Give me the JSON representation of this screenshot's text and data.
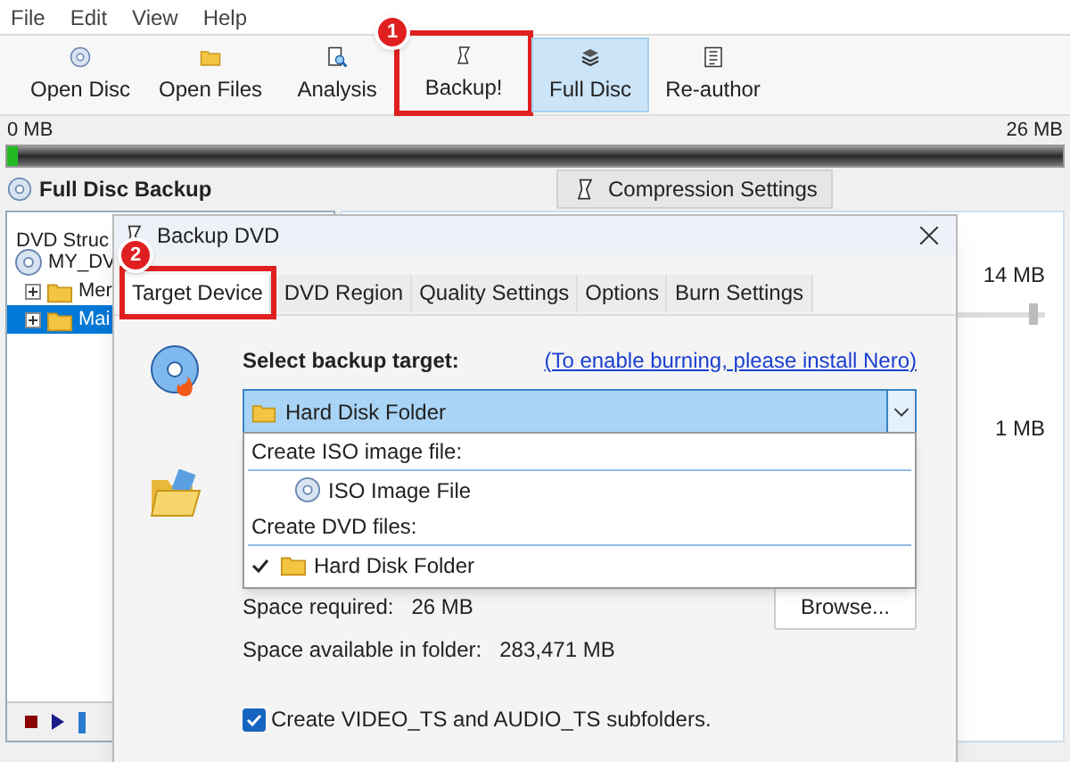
{
  "menu": [
    "File",
    "Edit",
    "View",
    "Help"
  ],
  "toolbar": [
    {
      "label": "Open Disc",
      "kind": "disc",
      "selected": false
    },
    {
      "label": "Open Files",
      "kind": "folder",
      "selected": false
    },
    {
      "label": "Analysis",
      "kind": "magnifier",
      "selected": false
    },
    {
      "label": "Backup!",
      "kind": "scroll",
      "selected": false,
      "callout": "1"
    },
    {
      "label": "Full Disc",
      "kind": "stack",
      "selected": true
    },
    {
      "label": "Re-author",
      "kind": "list",
      "selected": false
    }
  ],
  "size_scale": {
    "start": "0 MB",
    "end": "26 MB",
    "level": 0.01
  },
  "section_title": "Full Disc Backup",
  "compression_button": "Compression Settings",
  "tree": {
    "heading": "DVD Struc",
    "items": [
      {
        "label": "MY_DV",
        "kind": "disc",
        "selected": false,
        "children": [
          {
            "label": "Mer",
            "kind": "folder",
            "expanded": false,
            "selected": false
          },
          {
            "label": "Mai",
            "kind": "folder",
            "expanded": false,
            "selected": true
          }
        ]
      }
    ]
  },
  "readings": [
    {
      "text": "14 MB",
      "level": 0.9
    },
    {
      "text": "1 MB"
    }
  ],
  "dialog": {
    "title": "Backup DVD",
    "tabs": [
      {
        "label": "Target Device",
        "selected": true,
        "callout": "2"
      },
      {
        "label": "DVD Region",
        "selected": false
      },
      {
        "label": "Quality Settings",
        "selected": false
      },
      {
        "label": "Options",
        "selected": false
      },
      {
        "label": "Burn Settings",
        "selected": false
      }
    ],
    "select_label": "Select backup target:",
    "nero_link": "(To enable burning, please install Nero)",
    "target": {
      "value": "Hard Disk Folder",
      "expanded": true
    },
    "options": [
      {
        "header": "Create ISO image file:",
        "items": [
          {
            "label": "ISO Image File",
            "kind": "disc",
            "checked": false
          }
        ]
      },
      {
        "header": "Create DVD files:",
        "items": [
          {
            "label": "Hard Disk Folder",
            "kind": "folder",
            "checked": true
          }
        ]
      }
    ],
    "space_required": {
      "label": "Space required:",
      "value": "26 MB"
    },
    "browse_button": "Browse...",
    "space_available": {
      "label": "Space available in folder:",
      "value": "283,471 MB"
    },
    "subfolders": {
      "label": "Create VIDEO_TS and AUDIO_TS subfolders.",
      "checked": true
    }
  }
}
